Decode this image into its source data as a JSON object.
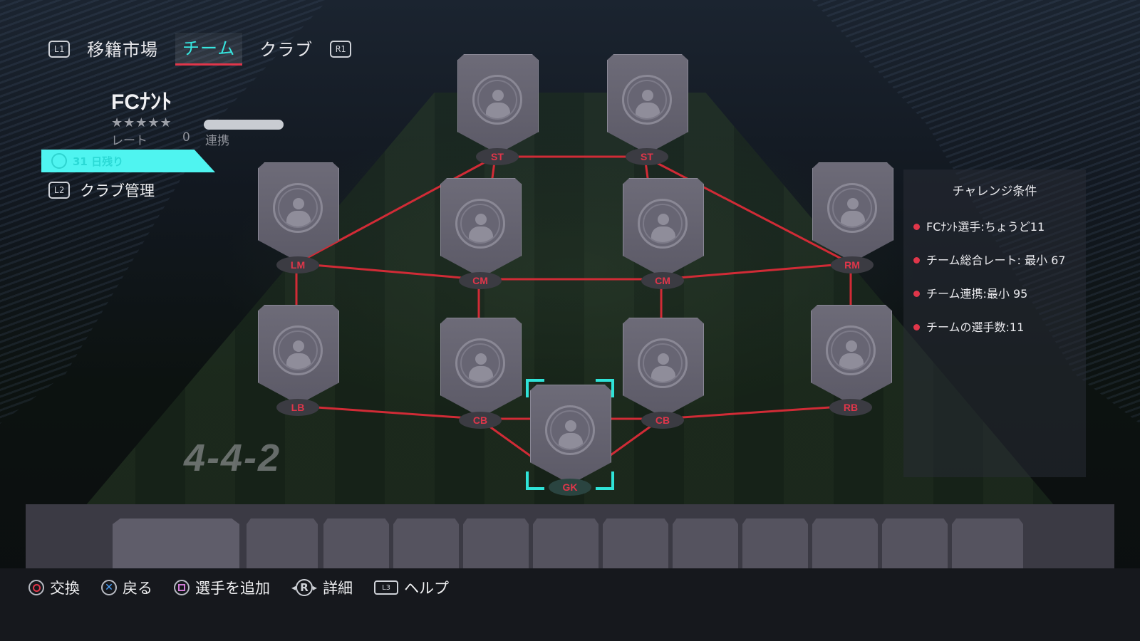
{
  "nav": {
    "left_hint": "L1",
    "right_hint": "R1",
    "tabs": [
      {
        "label": "移籍市場",
        "active": false
      },
      {
        "label": "チーム",
        "active": true
      },
      {
        "label": "クラブ",
        "active": false
      }
    ]
  },
  "club": {
    "name": "FCﾅﾝﾄ",
    "stars": "★★★★★",
    "rate_label": "レート",
    "rate_value": "0",
    "chem_label": "連携",
    "timer": "31 日残り",
    "manage_hint": "L2",
    "manage_label": "クラブ管理"
  },
  "formation": "4-4-2",
  "positions": [
    "ST",
    "ST",
    "LM",
    "CM",
    "CM",
    "RM",
    "LB",
    "CB",
    "CB",
    "RB",
    "GK"
  ],
  "challenge": {
    "title": "チャレンジ条件",
    "requirements": [
      "FCﾅﾝﾄ選手:ちょうど11",
      "チーム総合レート: 最小 67",
      "チーム連携:最小 95",
      "チームの選手数:11"
    ]
  },
  "bottom_hints": [
    {
      "icon": "circle-button-icon",
      "label": "交換"
    },
    {
      "icon": "cross-button-icon",
      "label": "戻る"
    },
    {
      "icon": "square-button-icon",
      "label": "選手を追加"
    },
    {
      "icon": "right-stick-icon",
      "label": "詳細",
      "glyph": "R"
    },
    {
      "icon": "touchpad-icon",
      "label": "ヘルプ",
      "glyph": "L3"
    }
  ],
  "colors": {
    "accent_cyan": "#37e6e0",
    "link_red": "#e0364a",
    "card_gray": "#5c5a67"
  }
}
